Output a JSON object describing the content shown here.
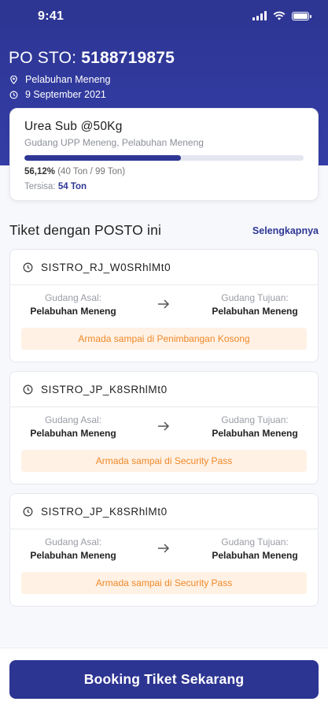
{
  "status_bar": {
    "time": "9:41"
  },
  "header": {
    "po_label": "PO STO:",
    "po_number": "5188719875",
    "location": "Pelabuhan Meneng",
    "date": "9 September 2021"
  },
  "product": {
    "name": "Urea Sub @50Kg",
    "warehouse": "Gudang UPP Meneng, Pelabuhan Meneng",
    "progress_fraction": 0.5612,
    "progress_pct": "56,12%",
    "progress_detail": "(40 Ton / 99 Ton)",
    "remaining_label": "Tersisa:",
    "remaining_value": "54 Ton"
  },
  "tickets_section": {
    "title": "Tiket dengan POSTO ini",
    "see_all": "Selengkapnya"
  },
  "tickets": [
    {
      "id": "SISTRO_RJ_W0SRhlMt0",
      "from_label": "Gudang Asal:",
      "from_value": "Pelabuhan Meneng",
      "to_label": "Gudang Tujuan:",
      "to_value": "Pelabuhan Meneng",
      "status": "Armada sampai di Penimbangan Kosong"
    },
    {
      "id": "SISTRO_JP_K8SRhlMt0",
      "from_label": "Gudang Asal:",
      "from_value": "Pelabuhan Meneng",
      "to_label": "Gudang Tujuan:",
      "to_value": "Pelabuhan Meneng",
      "status": "Armada sampai di Security Pass"
    },
    {
      "id": "SISTRO_JP_K8SRhlMt0",
      "from_label": "Gudang Asal:",
      "from_value": "Pelabuhan Meneng",
      "to_label": "Gudang Tujuan:",
      "to_value": "Pelabuhan Meneng",
      "status": "Armada sampai di Security Pass"
    }
  ],
  "cta": {
    "label": "Booking Tiket Sekarang"
  },
  "colors": {
    "primary": "#2d3592",
    "status_bg": "#fff1e4",
    "status_text": "#f0892a"
  }
}
